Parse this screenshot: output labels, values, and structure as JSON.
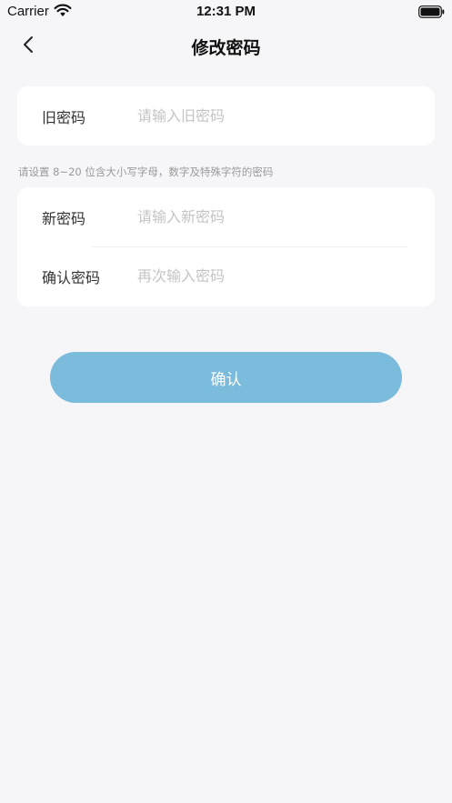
{
  "status_bar": {
    "carrier": "Carrier",
    "time": "12:31 PM",
    "wifi_icon": "wifi-icon",
    "battery_icon": "battery-icon"
  },
  "nav": {
    "back_icon": "chevron-left-icon",
    "title": "修改密码"
  },
  "form": {
    "old_password": {
      "label": "旧密码",
      "placeholder": "请输入旧密码",
      "value": ""
    },
    "hint": "请设置 8~20 位含大小写字母，数字及特殊字符的密码",
    "new_password": {
      "label": "新密码",
      "placeholder": "请输入新密码",
      "value": ""
    },
    "confirm_password": {
      "label": "确认密码",
      "placeholder": "再次输入密码",
      "value": ""
    }
  },
  "confirm_button": {
    "label": "确认"
  },
  "colors": {
    "background": "#f6f6f9",
    "card": "#ffffff",
    "button": "#7bbbdc",
    "placeholder": "#c4c4c4",
    "hint": "#9a9a9a"
  }
}
